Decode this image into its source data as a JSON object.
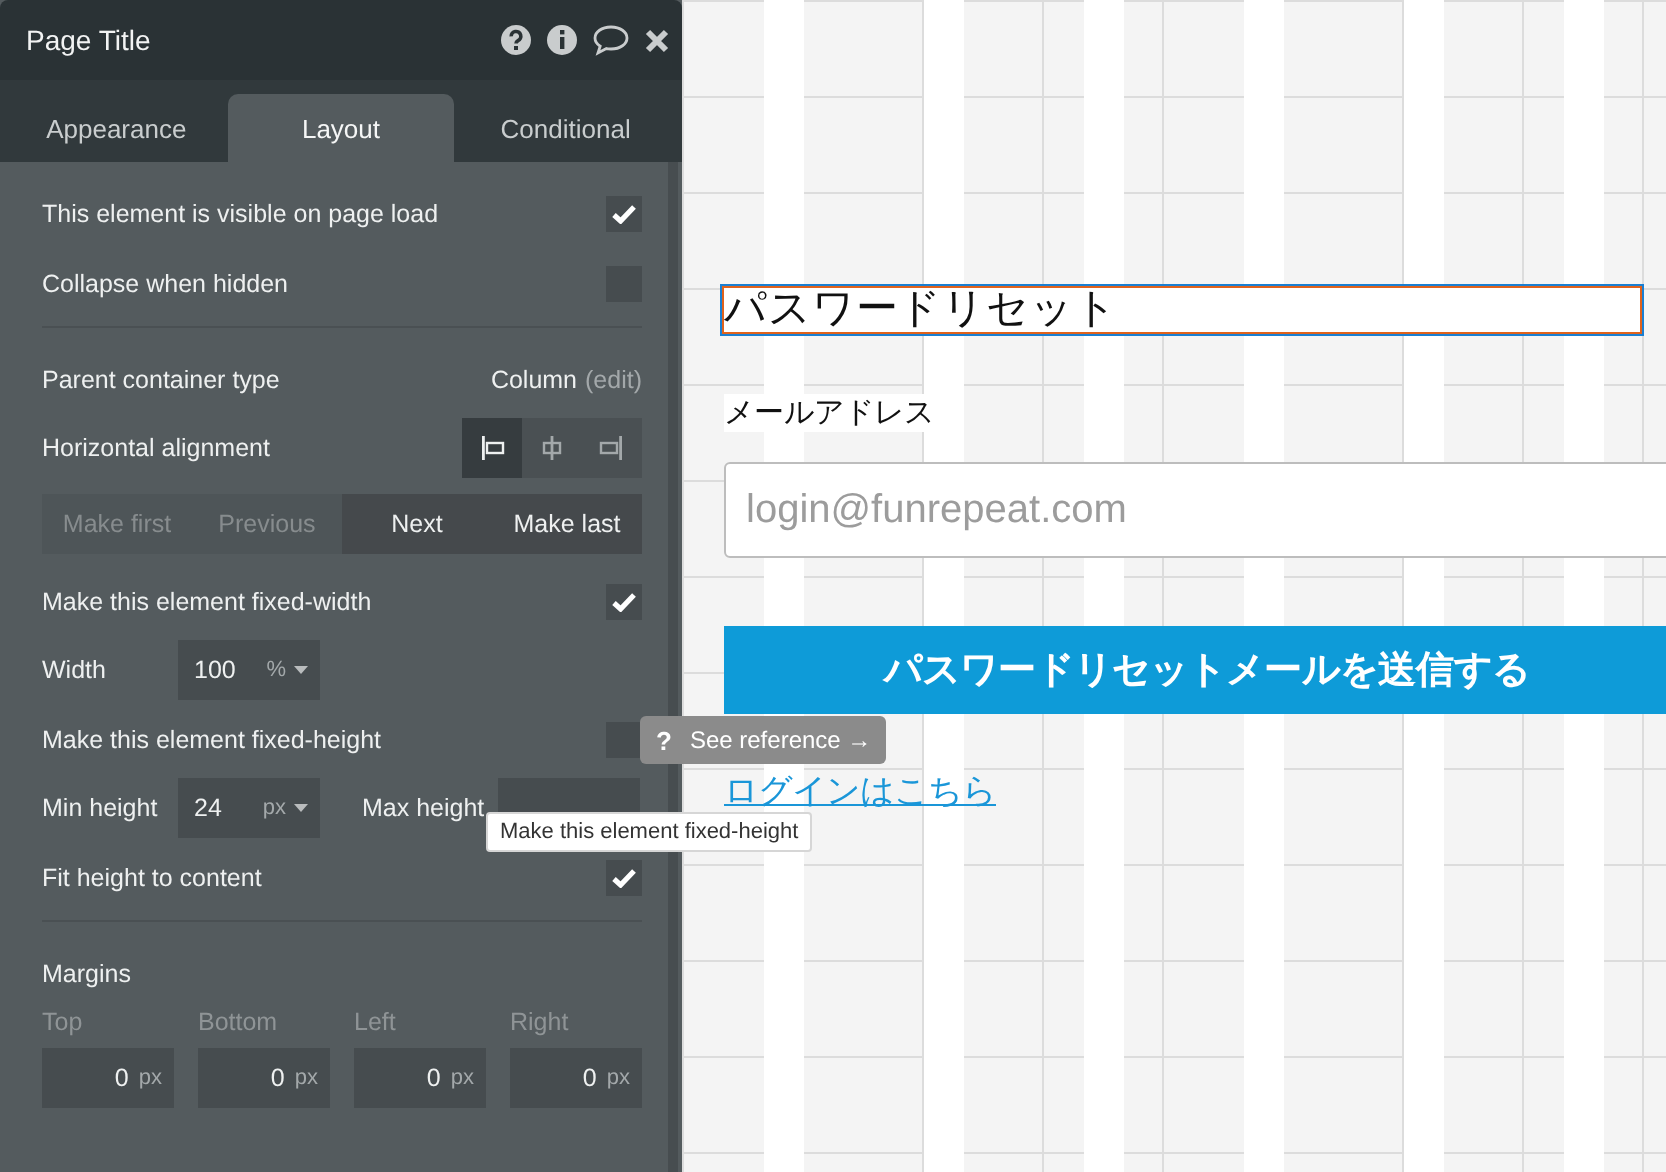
{
  "panel": {
    "title": "Page Title",
    "tabs": [
      {
        "label": "Appearance",
        "selected": false
      },
      {
        "label": "Layout",
        "selected": true
      },
      {
        "label": "Conditional",
        "selected": false
      }
    ],
    "sections": [
      {
        "rows": [
          {
            "kind": "checkbox",
            "label": "This element is visible on page load",
            "checked": true
          },
          {
            "kind": "checkbox",
            "label": "Collapse when hidden",
            "checked": false
          }
        ]
      },
      {
        "rows": [
          {
            "kind": "info",
            "label": "Parent container type",
            "value": "Column",
            "link": "(edit)"
          },
          {
            "kind": "alignment",
            "label": "Horizontal alignment",
            "options": [
              {
                "kind": "left",
                "selected": true
              },
              {
                "kind": "center",
                "selected": false
              },
              {
                "kind": "right",
                "selected": false
              }
            ]
          },
          {
            "kind": "order",
            "buttons": [
              {
                "label": "Make first",
                "disabled": true
              },
              {
                "label": "Previous",
                "disabled": true
              },
              {
                "label": "Next",
                "disabled": false
              },
              {
                "label": "Make last",
                "disabled": false
              }
            ]
          },
          {
            "kind": "checkbox",
            "label": "Make this element fixed-width",
            "checked": true
          },
          {
            "kind": "fields",
            "fields": [
              {
                "label": "Width",
                "value": "100",
                "unit": "%",
                "dropdown": true
              }
            ]
          },
          {
            "kind": "checkbox",
            "label": "Make this element fixed-height",
            "checked": false
          },
          {
            "kind": "fields",
            "fields": [
              {
                "label": "Min height",
                "value": "24",
                "unit": "px",
                "dropdown": true
              },
              {
                "label": "Max height"
              }
            ]
          },
          {
            "kind": "checkbox",
            "label": "Fit height to content",
            "checked": true
          }
        ]
      },
      {
        "rows": [
          {
            "kind": "heading",
            "label": "Margins"
          },
          {
            "kind": "margins",
            "fields": [
              {
                "label": "Top",
                "value": "0",
                "unit": "px"
              },
              {
                "label": "Bottom",
                "value": "0",
                "unit": "px"
              },
              {
                "label": "Left",
                "value": "0",
                "unit": "px"
              },
              {
                "label": "Right",
                "value": "0",
                "unit": "px"
              }
            ]
          }
        ]
      }
    ]
  },
  "canvas": {
    "title": "パスワードリセット",
    "email_label": "メールアドレス",
    "email_placeholder": "login@funrepeat.com",
    "submit_button": "パスワードリセットメールを送信する",
    "login_link": "ログインはこちら"
  },
  "reference_tip": {
    "mark": "?",
    "label": "See reference →"
  },
  "tooltip": "Make this element fixed-height"
}
